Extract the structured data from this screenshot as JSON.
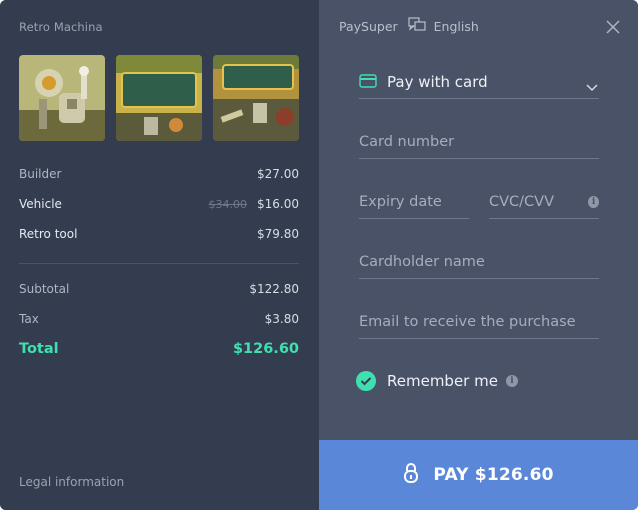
{
  "left": {
    "store_title": "Retro Machina",
    "thumbnails": [
      {
        "logo_text": "",
        "alt": "robot-artwork"
      },
      {
        "logo_text": "RETRO MACHINA",
        "alt": "retro-machina-logo"
      },
      {
        "logo_text": "RETRO MACHINA",
        "alt": "retro-machina-scene"
      }
    ],
    "items": [
      {
        "name": "Builder",
        "old_price": "",
        "price": "$27.00"
      },
      {
        "name": "Vehicle",
        "old_price": "$34.00",
        "price": "$16.00"
      },
      {
        "name": "Retro tool",
        "old_price": "",
        "price": "$79.80"
      }
    ],
    "subtotal": {
      "label": "Subtotal",
      "value": "$122.80"
    },
    "tax": {
      "label": "Tax",
      "value": "$3.80"
    },
    "total": {
      "label": "Total",
      "value": "$126.60"
    },
    "legal": "Legal information"
  },
  "right": {
    "brand": "PaySuper",
    "language": "English",
    "payment_method": "Pay with card",
    "fields": {
      "card_number": "Card number",
      "expiry": "Expiry date",
      "cvc": "CVC/CVV",
      "cardholder": "Cardholder name",
      "email": "Email to receive the purchase"
    },
    "remember_me": "Remember me",
    "remember_checked": true,
    "pay_button": "PAY $126.60"
  },
  "colors": {
    "left_bg": "#343c4f",
    "right_bg": "#4a5268",
    "accent_green": "#3fe0b0",
    "pay_blue": "#5b87d8"
  },
  "icons": [
    "translate-icon",
    "close-icon",
    "card-icon",
    "chevron-down-icon",
    "info-icon",
    "check-icon",
    "lock-icon"
  ]
}
